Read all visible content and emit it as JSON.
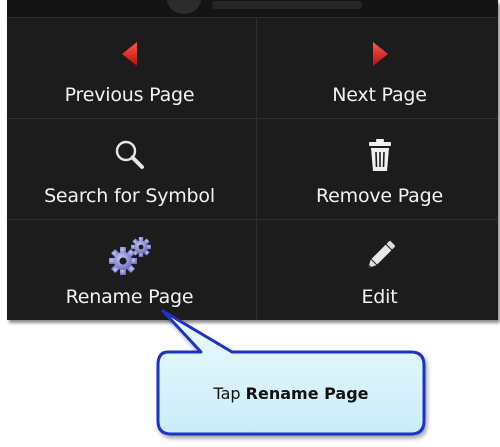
{
  "menu": {
    "items": [
      {
        "label": "Previous Page",
        "icon": "arrow-left-icon"
      },
      {
        "label": "Next Page",
        "icon": "arrow-right-icon"
      },
      {
        "label": "Search for Symbol",
        "icon": "magnifier-icon"
      },
      {
        "label": "Remove Page",
        "icon": "trash-icon"
      },
      {
        "label": "Rename Page",
        "icon": "gears-icon"
      },
      {
        "label": "Edit",
        "icon": "pencil-icon"
      }
    ]
  },
  "callout": {
    "prefix": "Tap ",
    "emphasis": "Rename Page"
  },
  "colors": {
    "menu_background": "#1c1c1c",
    "arrow_red": "#e11b1b",
    "callout_border": "#1b33c8",
    "callout_fill": "#d9f3fc"
  }
}
